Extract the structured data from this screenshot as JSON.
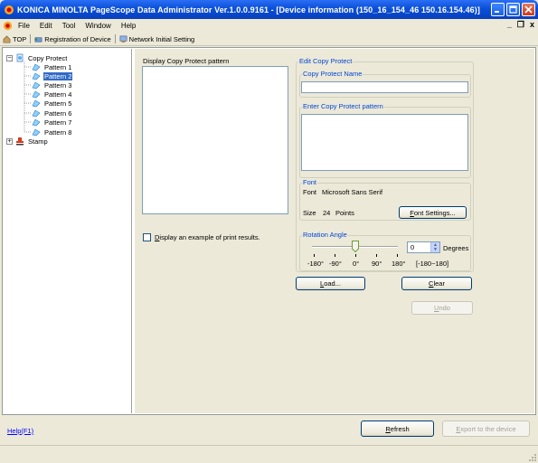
{
  "window": {
    "title": "KONICA MINOLTA PageScope Data Administrator Ver.1.0.0.9161 - [Device information (150_16_154_46 150.16.154.46)]",
    "icon": "app-icon",
    "colors": {
      "titlebar": "#0a4fd8",
      "selection": "#316ac5",
      "group_title": "#0046d5",
      "link": "#0000ff"
    }
  },
  "menubar": {
    "items": [
      {
        "label": "File"
      },
      {
        "label": "Edit"
      },
      {
        "label": "Tool"
      },
      {
        "label": "Window"
      },
      {
        "label": "Help"
      }
    ],
    "mdi_minimize": "_",
    "mdi_restore": "̸",
    "mdi_close": "x"
  },
  "toolbar": {
    "top_label": "TOP",
    "registration_label": "Registration of Device",
    "network_label": "Network Initial Setting"
  },
  "tree": {
    "root_label": "Copy Protect",
    "root_expander": "−",
    "patterns": [
      {
        "label": "Pattern 1"
      },
      {
        "label": "Pattern 2"
      },
      {
        "label": "Pattern 3"
      },
      {
        "label": "Pattern 4"
      },
      {
        "label": "Pattern 5"
      },
      {
        "label": "Pattern 6"
      },
      {
        "label": "Pattern 7"
      },
      {
        "label": "Pattern 8"
      }
    ],
    "selected_pattern": "Pattern 2",
    "stamp_label": "Stamp",
    "stamp_expander": "+"
  },
  "display": {
    "label": "Display Copy Protect pattern",
    "example_checkbox_label": "Display an example of print results.",
    "example_checked": false
  },
  "edit": {
    "group_title": "Edit Copy Protect",
    "name_label": "Copy Protect Name",
    "name_value": "",
    "pattern_label": "Enter Copy Protect pattern",
    "pattern_value": ""
  },
  "font": {
    "group_title": "Font",
    "font_key": "Font",
    "font_value": "Microsoft Sans Serif",
    "size_key": "Size",
    "size_value": "24",
    "size_unit": "Points",
    "settings_button": "Font Settings..."
  },
  "rotation": {
    "group_title": "Rotation Angle",
    "value": "0",
    "unit": "Degrees",
    "ticks": [
      "-180°",
      "-90°",
      "0°",
      "90°",
      "180°"
    ],
    "range_hint": "[-180~180]"
  },
  "actions": {
    "load": "Load...",
    "clear": "Clear",
    "undo": "Undo"
  },
  "bottom": {
    "help": "Help(F1)",
    "refresh": "Refresh",
    "export": "Export to the device"
  }
}
